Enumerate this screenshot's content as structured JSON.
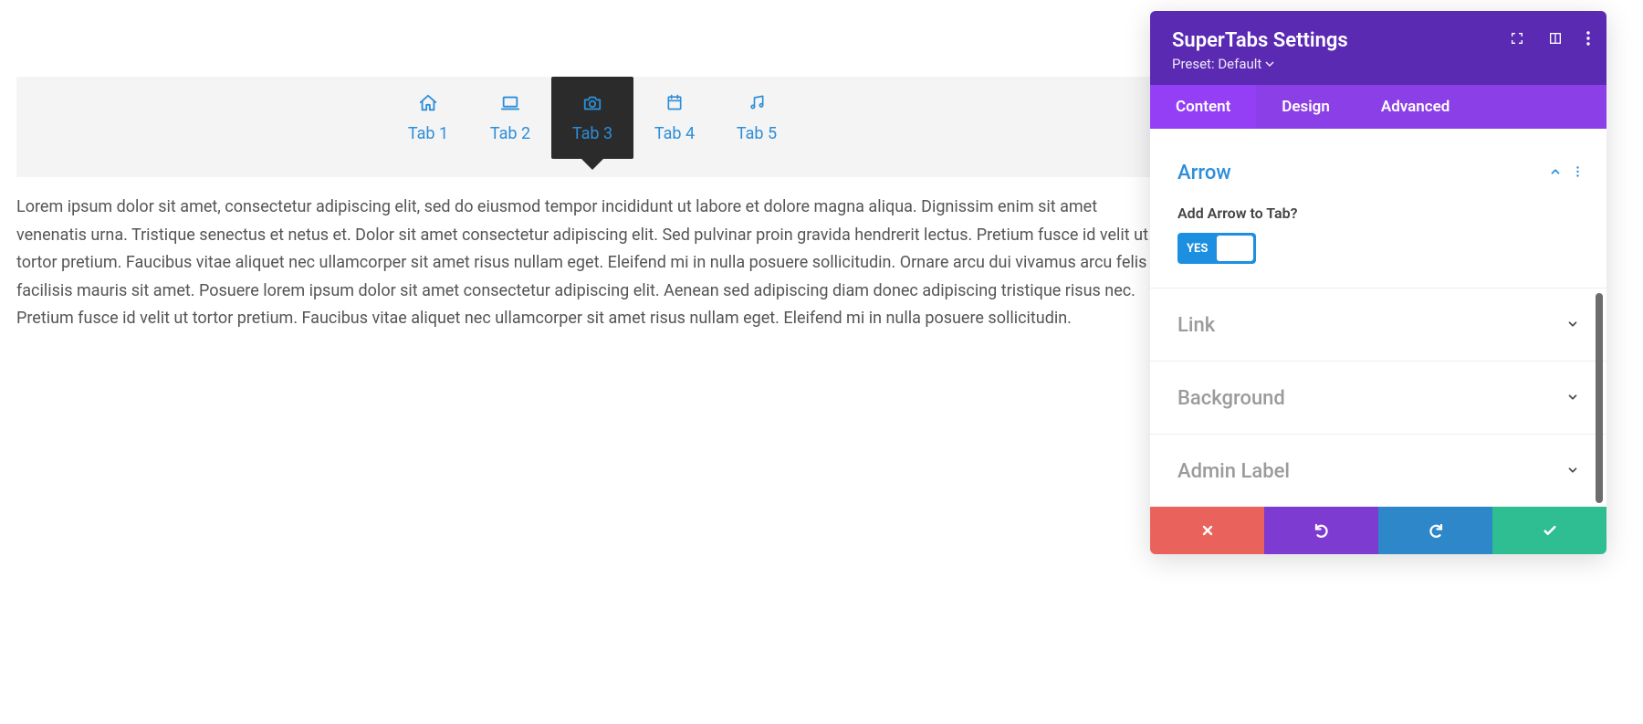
{
  "preview": {
    "tabs": [
      {
        "label": "Tab 1",
        "icon": "home-icon"
      },
      {
        "label": "Tab 2",
        "icon": "laptop-icon"
      },
      {
        "label": "Tab 3",
        "icon": "camera-icon"
      },
      {
        "label": "Tab 4",
        "icon": "calendar-icon"
      },
      {
        "label": "Tab 5",
        "icon": "music-icon"
      }
    ],
    "active_index": 2,
    "content": "Lorem ipsum dolor sit amet, consectetur adipiscing elit, sed do eiusmod tempor incididunt ut labore et dolore magna aliqua. Dignissim enim sit amet venenatis urna. Tristique senectus et netus et. Dolor sit amet consectetur adipiscing elit. Sed pulvinar proin gravida hendrerit lectus. Pretium fusce id velit ut tortor pretium. Faucibus vitae aliquet nec ullamcorper sit amet risus nullam eget. Eleifend mi in nulla posuere sollicitudin. Ornare arcu dui vivamus arcu felis facilisis mauris sit amet. Posuere lorem ipsum dolor sit amet consectetur adipiscing elit. Aenean sed adipiscing diam donec adipiscing tristique risus nec. Pretium fusce id velit ut tortor pretium. Faucibus vitae aliquet nec ullamcorper sit amet risus nullam eget. Eleifend mi in nulla posuere sollicitudin."
  },
  "panel": {
    "title": "SuperTabs Settings",
    "preset_label": "Preset: Default",
    "tabs": {
      "content": "Content",
      "design": "Design",
      "advanced": "Advanced",
      "active": "content"
    },
    "sections": {
      "arrow": {
        "title": "Arrow",
        "expanded": true,
        "field_label": "Add Arrow to Tab?",
        "toggle_value": "YES"
      },
      "link": {
        "title": "Link",
        "expanded": false
      },
      "background": {
        "title": "Background",
        "expanded": false
      },
      "admin_label": {
        "title": "Admin Label",
        "expanded": false
      }
    }
  },
  "colors": {
    "accent_blue": "#2d8ed9",
    "panel_purple": "#5b2ab3",
    "tab_active_bg": "#2b2b2b"
  }
}
